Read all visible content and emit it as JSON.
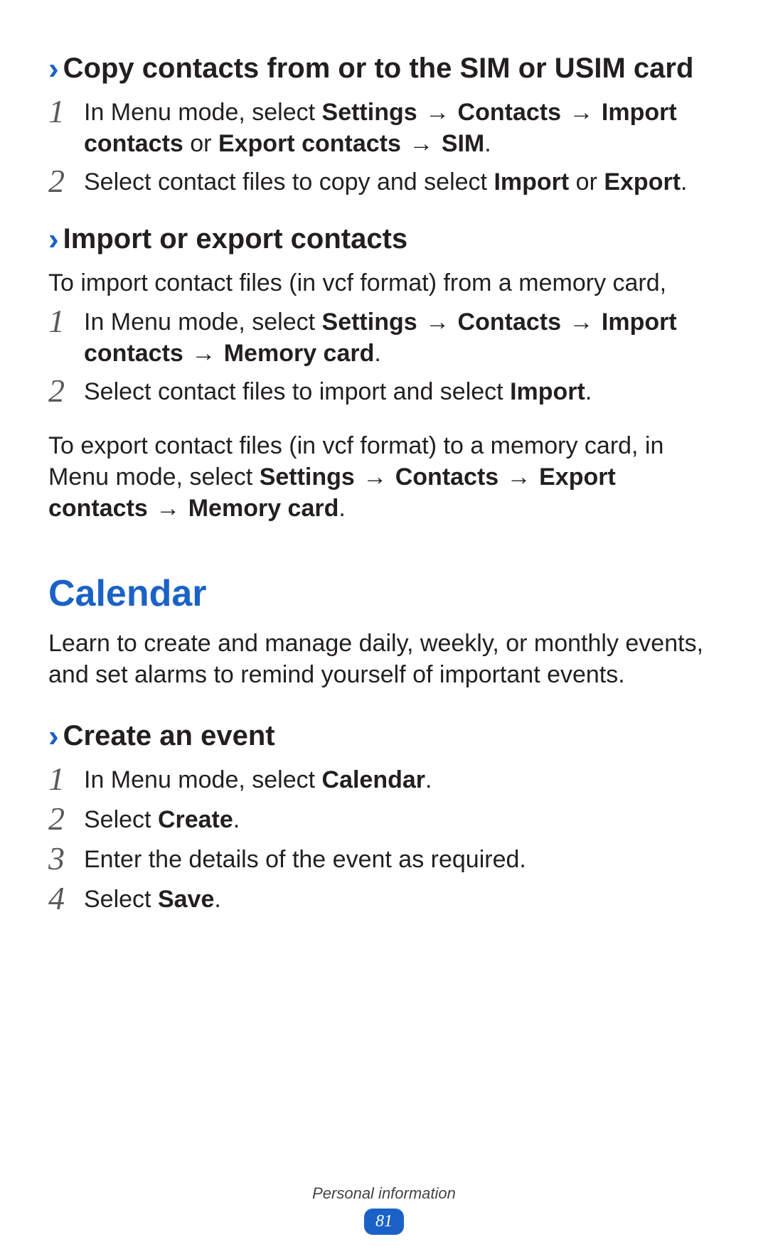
{
  "glyphs": {
    "chevron": "›",
    "arrow": "→"
  },
  "section1": {
    "title": "Copy contacts from or to the SIM or USIM card",
    "steps": [
      {
        "num": "1",
        "pre": "In Menu mode, select ",
        "b1": "Settings",
        "mid1": " ",
        "b2": "Contacts",
        "mid2": " ",
        "b3": "Import contacts",
        "mid3": " or ",
        "b4": "Export contacts",
        "mid4": " ",
        "b5": "SIM",
        "post": "."
      },
      {
        "num": "2",
        "pre": "Select contact files to copy and select ",
        "b1": "Import",
        "mid1": " or ",
        "b2": "Export",
        "post": "."
      }
    ]
  },
  "section2": {
    "title": "Import or export contacts",
    "intro": "To import contact files (in vcf format) from a memory card,",
    "steps": [
      {
        "num": "1",
        "pre": "In Menu mode, select ",
        "b1": "Settings",
        "mid1": " ",
        "b2": "Contacts",
        "mid2": " ",
        "b3": "Import contacts",
        "mid3": " ",
        "b4": "Memory card",
        "post": "."
      },
      {
        "num": "2",
        "pre": "Select contact files to import and select ",
        "b1": "Import",
        "post": "."
      }
    ],
    "para": {
      "pre": "To export contact files (in vcf format) to a memory card, in Menu mode, select ",
      "b1": "Settings",
      "mid1": " ",
      "b2": "Contacts",
      "mid2": " ",
      "b3": "Export contacts",
      "mid3": " ",
      "b4": "Memory card",
      "post": "."
    }
  },
  "calendar": {
    "title": "Calendar",
    "intro": "Learn to create and manage daily, weekly, or monthly events, and set alarms to remind yourself of important events."
  },
  "section3": {
    "title": "Create an event",
    "steps": [
      {
        "num": "1",
        "pre": "In Menu mode, select ",
        "b1": "Calendar",
        "post": "."
      },
      {
        "num": "2",
        "pre": "Select ",
        "b1": "Create",
        "post": "."
      },
      {
        "num": "3",
        "pre": "Enter the details of the event as required.",
        "post": ""
      },
      {
        "num": "4",
        "pre": "Select ",
        "b1": "Save",
        "post": "."
      }
    ]
  },
  "footer": {
    "label": "Personal information",
    "page": "81"
  }
}
